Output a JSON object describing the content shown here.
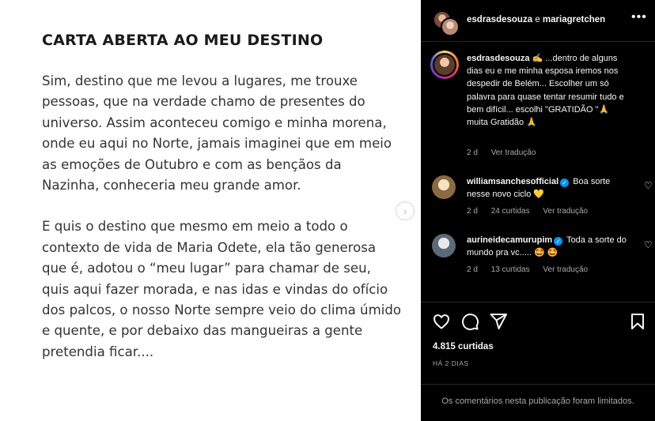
{
  "post": {
    "title": "CARTA ABERTA AO MEU DESTINO",
    "paragraphs": [
      "Sim, destino que me levou a lugares, me trouxe pessoas, que na verdade chamo de presentes do universo. Assim aconteceu comigo e minha morena, onde eu aqui no Norte, jamais imaginei que em meio as emoções de Outubro e com as bençãos da Nazinha, conheceria meu grande amor.",
      "E quis o destino que mesmo em meio a todo o contexto de vida de Maria Odete, ela tão generosa que é, adotou o “meu lugar” para chamar de seu, quis aqui fazer morada, e nas idas e vindas do ofício dos palcos, o nosso Norte sempre veio do clima úmido e quente, e por debaixo das mangueiras a gente pretendia ficar...."
    ],
    "next_icon": "chevron-right-icon"
  },
  "header": {
    "user1": "esdrasdesouza",
    "connector": "e",
    "user2": "mariagretchen",
    "more_icon": "more-horizontal-icon"
  },
  "caption": {
    "username": "esdrasdesouza",
    "text": "✍️ ...dentro de alguns dias eu e me minha esposa iremos nos despedir de Belém... Escolher um só palavra para quase tentar resumir tudo e bem difícil... escolhi \"GRATIDÃO \"🙏 muita Gratidão 🙏",
    "time": "2 d",
    "translate": "Ver tradução"
  },
  "comments": [
    {
      "username": "williamsanchesofficial",
      "verified": true,
      "text": "Boa sorte nesse novo ciclo 💛",
      "time": "2 d",
      "likes": "24 curtidas",
      "translate": "Ver tradução"
    },
    {
      "username": "aurineidecamurupim",
      "verified": true,
      "text": "Toda a sorte do mundo pra vc..... 🤩 🤩",
      "time": "2 d",
      "likes": "13 curtidas",
      "translate": "Ver tradução"
    }
  ],
  "actions": {
    "likes": "4.815 curtidas",
    "date": "HÁ 2 DIAS",
    "comments_limited": "Os comentários nesta publicação foram limitados."
  }
}
